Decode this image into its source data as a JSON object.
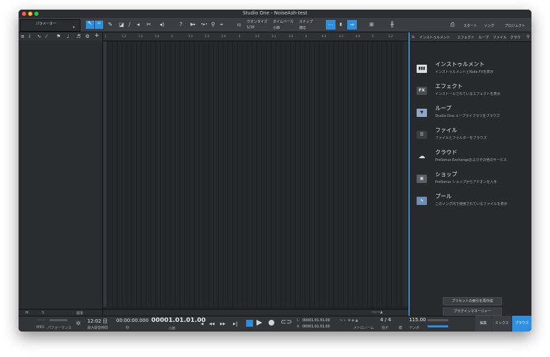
{
  "window": {
    "title": "Studio One - NoiseAsh-test"
  },
  "toolbar": {
    "param_label": "パラメーター",
    "quantize_label": "クオンタイズ",
    "quantize_value": "1/16",
    "timebase_label": "タイムベース",
    "timebase_value": "小節",
    "snap_label": "スナップ",
    "snap_value": "適応",
    "iq": "IQ",
    "nav_start": "スタート",
    "nav_song": "ソング",
    "nav_project": "プロジェクト"
  },
  "ruler": {
    "marks": [
      "1",
      "1.2",
      "1.3",
      "1.4",
      "2",
      "2.2",
      "2.3",
      "2.4",
      "3",
      "3.2",
      "3.3",
      "3.4",
      "4",
      "4.2",
      "4.3",
      "4.4",
      "5",
      "5.2"
    ]
  },
  "track_footer": {
    "m": "M",
    "s": "S",
    "std": "標準"
  },
  "browser": {
    "tabs": [
      "インストゥルメント",
      "エフェクト",
      "ループ",
      "ファイル",
      "クラウ"
    ],
    "items": [
      {
        "icon": "piano-icon",
        "title": "インストゥルメント",
        "desc": "インストゥルメントとNote FXを表示"
      },
      {
        "icon": "fx-icon",
        "title": "エフェクト",
        "desc": "インストールされているエフェクトを表示",
        "glyph": "FX"
      },
      {
        "icon": "loop-icon",
        "title": "ループ",
        "desc": "Studio One ループライブラリをブラウズ"
      },
      {
        "icon": "file-icon",
        "title": "ファイル",
        "desc": "ファイルとフォルダーをブラウズ"
      },
      {
        "icon": "cloud-icon",
        "title": "クラウド",
        "desc": "PreSonus Exchangeおよびその他のサービス"
      },
      {
        "icon": "shop-icon",
        "title": "ショップ",
        "desc": "PreSonus ショップからアドオンを入手"
      },
      {
        "icon": "pool-icon",
        "title": "プール",
        "desc": "このソング内で使用されているファイルを表示"
      }
    ],
    "rebuild_preset_index": "プリセットの索引を再作成",
    "plugin_manager": "プラグインマネージャー"
  },
  "transport": {
    "midi": "MIDI",
    "performance": "パフォーマンス",
    "time": "12:02 日",
    "max_rec": "最大録音時間",
    "seconds": "00:00:00.000",
    "sec_label": "秒",
    "bars": "00001.01.01.00",
    "bars_label": "小節",
    "l_pos": "00001.01.01.00",
    "r_pos": "00001.01.01.00",
    "l_label": "L",
    "r_label": "R",
    "metronome": "メトロノーム",
    "sig": "4 / 4",
    "sig_label": "拍子",
    "key_label": "鍵",
    "tempo": "115.00",
    "tempo_label": "テンポ",
    "tab_edit": "編集",
    "tab_mix": "ミックス",
    "tab_browse": "ブラウズ"
  },
  "colors": {
    "accent": "#2e8fe0",
    "bg": "#1c1e21"
  }
}
